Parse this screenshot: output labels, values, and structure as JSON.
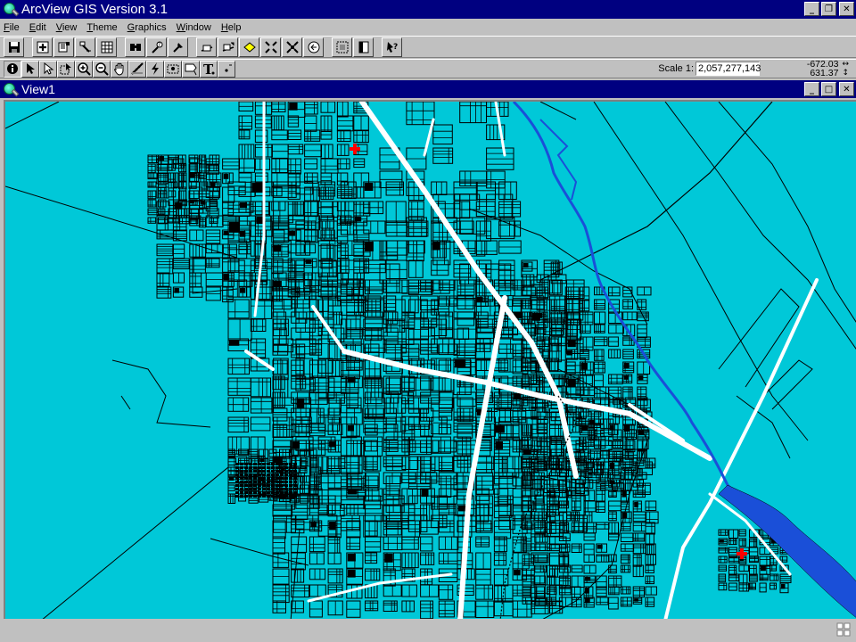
{
  "app": {
    "title": "ArcView GIS Version 3.1",
    "caption_buttons": [
      "minimize",
      "restore",
      "close"
    ]
  },
  "menu": {
    "items": [
      {
        "label": "File",
        "accel": "F"
      },
      {
        "label": "Edit",
        "accel": "E"
      },
      {
        "label": "View",
        "accel": "V"
      },
      {
        "label": "Theme",
        "accel": "T"
      },
      {
        "label": "Graphics",
        "accel": "G"
      },
      {
        "label": "Window",
        "accel": "W"
      },
      {
        "label": "Help",
        "accel": "H"
      }
    ]
  },
  "buttonbar": {
    "buttons": [
      "save-icon",
      "add-theme-icon",
      "theme-properties-icon",
      "edit-legend-icon",
      "open-table-icon",
      "find-icon",
      "query-builder-icon",
      "locate-address-icon",
      "zoom-full-extent-icon",
      "zoom-active-themes-icon",
      "zoom-selected-icon",
      "zoom-in-fixed-icon",
      "zoom-out-fixed-icon",
      "zoom-previous-icon",
      "select-none-icon",
      "layout-icon",
      "help-icon"
    ]
  },
  "toolbar": {
    "tools": [
      "identify-icon",
      "pointer-icon",
      "vertex-edit-icon",
      "select-feature-icon",
      "zoom-in-icon",
      "zoom-out-icon",
      "pan-icon",
      "measure-icon",
      "hot-link-icon",
      "area-of-interest-icon",
      "label-icon",
      "text-icon",
      "draw-point-icon"
    ],
    "scale_label": "Scale 1:",
    "scale_value": "2,057,277,143",
    "coord_x": "-672.03",
    "coord_y": "631.37",
    "coord_x_arrow": "↔",
    "coord_y_arrow": "↕"
  },
  "view": {
    "title": "View1",
    "water_color": "#00c8d8",
    "river_color": "#1a4fd8",
    "line_color": "#000000",
    "road_color": "#ffffff",
    "marker_color": "#ff0000"
  }
}
